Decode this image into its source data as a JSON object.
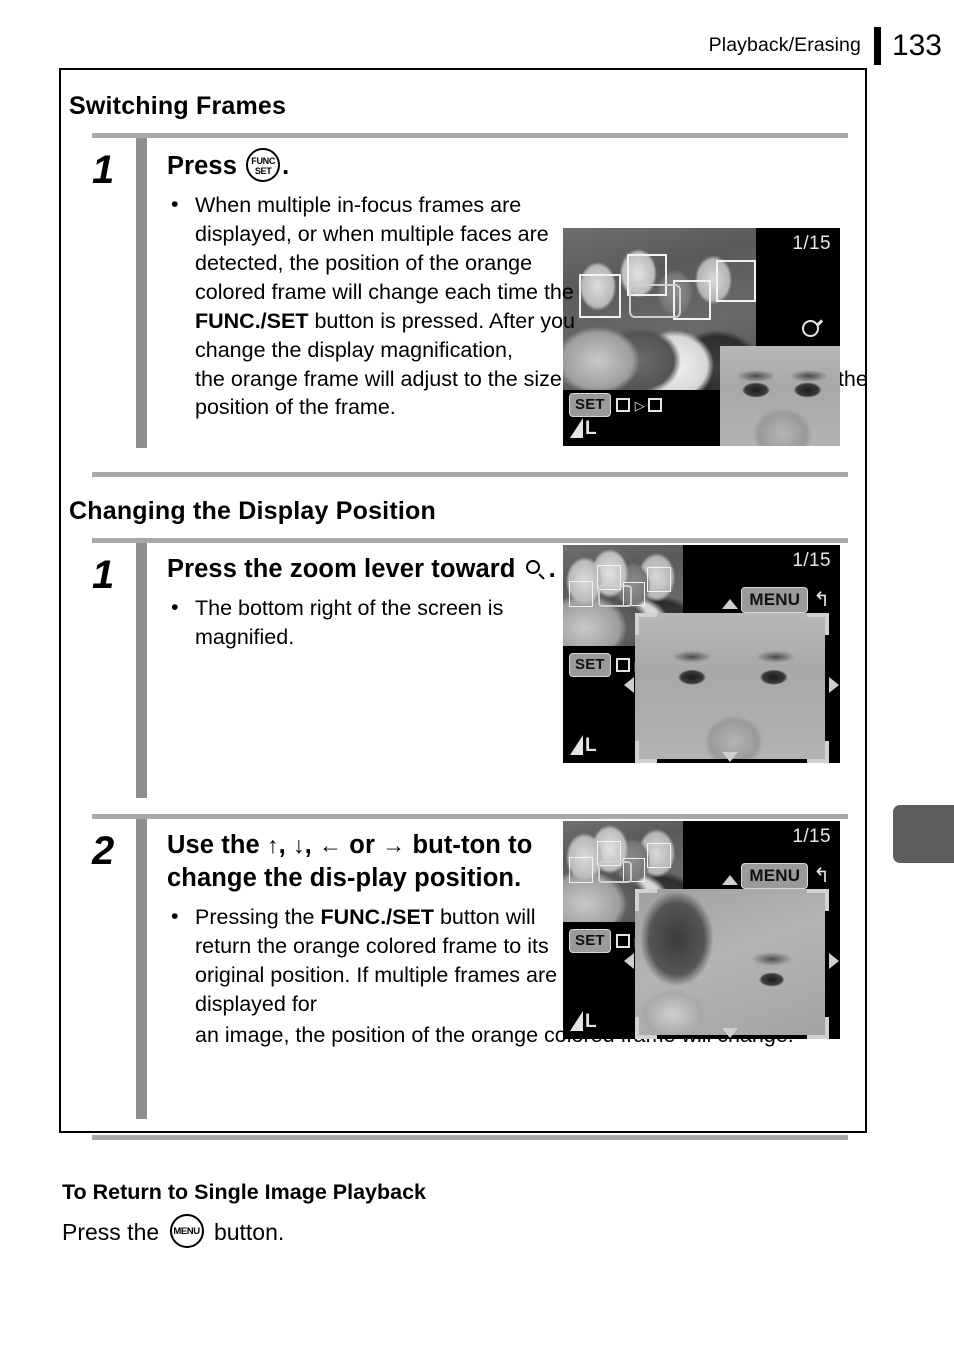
{
  "header": {
    "chapter": "Playback/Erasing",
    "page_number": "133"
  },
  "sections": [
    {
      "heading": "Switching Frames",
      "steps": [
        {
          "number": "1",
          "title_pre": "Press",
          "title_icon": "func-set-button-icon",
          "title_post": ".",
          "bullet_narrow": "When multiple in-focus frames are displayed, or when multiple faces are detected, the position of the orange colored frame will change each time the ",
          "bullet_bold_1": "FUNC./SET",
          "bullet_narrow_2": " button is pressed. After you change the display magnification,",
          "bullet_wrap": "the orange frame will adjust to the size of the face when you switch the position of the frame."
        }
      ]
    },
    {
      "heading": "Changing the Display Position",
      "steps": [
        {
          "number": "1",
          "title_pre": "Press the zoom lever toward",
          "title_icon": "magnify-icon",
          "title_post": ".",
          "bullet": "The bottom right of the screen is magnified."
        },
        {
          "number": "2",
          "title_a": "Use the",
          "arrow_up": "↑",
          "arrow_sep1": ",",
          "arrow_down": "↓",
          "arrow_sep2": ",",
          "arrow_left": "←",
          "title_or": "or",
          "arrow_right": "→",
          "title_b": "but-ton to change the dis-play position.",
          "bullet_pre": "Pressing the ",
          "bullet_bold": "FUNC./SET",
          "bullet_mid": " button will return the orange colored frame to its original position. If multiple frames are displayed for",
          "bullet_wrap": "an image, the position of the orange colored frame will change."
        }
      ]
    }
  ],
  "lcd_screens": [
    {
      "name": "lcd-switching-frames",
      "counter": "1/15",
      "set_label": "SET",
      "magnify_indicator": "magnify-icon",
      "quality_label": "L"
    },
    {
      "name": "lcd-display-position-1",
      "counter": "1/15",
      "set_label": "SET",
      "menu_label": "MENU",
      "back_arrow": "↰",
      "quality_label": "L"
    },
    {
      "name": "lcd-display-position-2",
      "counter": "1/15",
      "set_label": "SET",
      "menu_label": "MENU",
      "back_arrow": "↰",
      "quality_label": "L"
    }
  ],
  "bottom_note": {
    "title": "To Return to Single Image Playback",
    "line_pre": "Press the",
    "icon": "menu-button-icon",
    "line_post": "button.",
    "menu_icon_label": "MENU"
  },
  "icons": {
    "func_label_1": "FUNC",
    "func_label_2": "SET"
  },
  "colors": {
    "step_bar": "#8f8f8f",
    "separator": "#a8a8a8",
    "side_tab": "#5e5e5e",
    "lcd_background": "#000000"
  }
}
